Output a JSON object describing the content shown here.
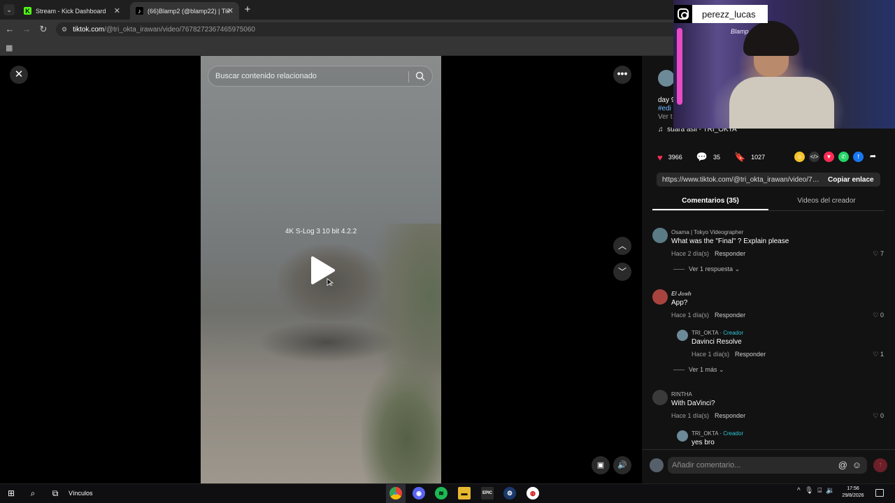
{
  "browser": {
    "tabs": [
      {
        "title": "Stream - Kick Dashboard",
        "favicon": "K"
      },
      {
        "title": "(66)Blamp2 (@blamp22) | TikTo",
        "favicon": "♪"
      }
    ],
    "url_site": "tiktok.com",
    "url_path": "/@tri_okta_irawan/video/7678272367465975060"
  },
  "video": {
    "search_placeholder": "Buscar contenido relacionado",
    "overlay_text": "4K S-Log 3 10 bit 4.2.2"
  },
  "post": {
    "desc_line1": "day 9",
    "desc_line2": "#edi",
    "desc_more": "Ver t",
    "music": "suara asli - TRI_OKTA",
    "likes": "3966",
    "comments_count": "35",
    "saves": "1027",
    "link": "https://www.tiktok.com/@tri_okta_irawan/video/76...",
    "copy_label": "Copiar enlace"
  },
  "panel_tabs": {
    "comments": "Comentarios (35)",
    "creator_videos": "Videos del creador"
  },
  "comments": [
    {
      "user": "Osama | Tokyo Videographer",
      "text": "What was the \"Final\" ? Explain please",
      "time": "Hace 2 día(s)",
      "reply": "Responder",
      "likes": "7",
      "more": "Ver 1 respuesta",
      "avatar_color": "#5a7a86"
    },
    {
      "user": "𝑬𝒍 𝑱𝒐𝒔𝒉",
      "text": "App?",
      "time": "Hace 1 día(s)",
      "reply": "Responder",
      "likes": "0",
      "avatar_color": "#a8443d",
      "reply_item": {
        "user": "TRI_OKTA",
        "badge": "Creador",
        "text": "Davinci Resolve",
        "time": "Hace 1 día(s)",
        "reply": "Responder",
        "likes": "1"
      },
      "more": "Ver 1 más"
    },
    {
      "user": "RINTHA",
      "text": "With DaVinci?",
      "time": "Hace 1 día(s)",
      "reply": "Responder",
      "likes": "0",
      "avatar_color": "#3a3a3a",
      "reply_item": {
        "user": "TRI_OKTA",
        "badge": "Creador",
        "text": "yes bro"
      }
    }
  ],
  "composer": {
    "placeholder": "Añadir comentario..."
  },
  "stream": {
    "instagram_handle": "perezz_lucas",
    "neon_sign": "Blamp"
  },
  "taskbar": {
    "links_label": "Vínculos",
    "time": "17:56",
    "date": "29/8/2026"
  },
  "colors": {
    "like": "#fe2c55",
    "creator_badge": "#2ec6d8",
    "hashtag": "#6db7ff"
  }
}
